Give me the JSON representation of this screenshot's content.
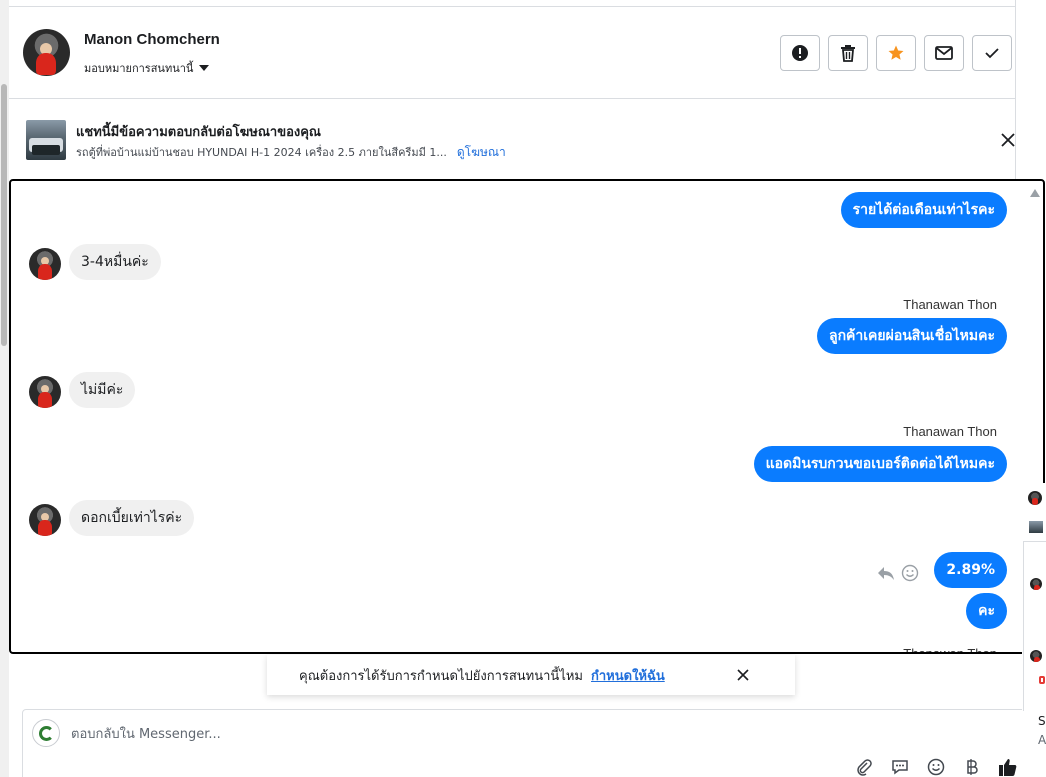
{
  "header": {
    "contact_name": "Manon Chomchern",
    "assign_label": "มอบหมายการสนทนานี้",
    "actions": [
      {
        "name": "report-button",
        "icon": "exclamation-circle-icon"
      },
      {
        "name": "delete-button",
        "icon": "trash-icon"
      },
      {
        "name": "star-button",
        "icon": "star-icon",
        "color": "#f7931e"
      },
      {
        "name": "mark-unread-button",
        "icon": "envelope-icon"
      },
      {
        "name": "mark-done-button",
        "icon": "check-icon"
      }
    ]
  },
  "ad": {
    "title": "แชทนี้มีข้อความตอบกลับต่อโฆษณาของคุณ",
    "description": "รถตู้ที่พ่อบ้านแม่บ้านชอบ HYUNDAI H-1 2024 เครื่อง 2.5 ภายในสีครีมมี 1...",
    "link_label": "ดูโฆษณา"
  },
  "messages": {
    "m1": "รายได้ต่อเดือนเท่าไรคะ",
    "m2": "3-4หมื่นค่ะ",
    "sender1": "Thanawan Thon",
    "m3": "ลูกค้าเคยผ่อนสินเชื่อไหมคะ",
    "m4": "ไม่มีค่ะ",
    "sender2": "Thanawan Thon",
    "m5": "แอดมินรบกวนขอเบอร์ติดต่อได้ไหมคะ",
    "m6": "ดอกเบี้ยเท่าไรค่ะ",
    "m7": "2.89%",
    "m8": "คะ",
    "sender3": "Thanawan Thon"
  },
  "toast": {
    "text": "คุณต้องการได้รับการกำหนดไปยังการสนทนานี้ไหม",
    "link": "กำหนดให้ฉัน"
  },
  "composer": {
    "placeholder": "ตอบกลับใน Messenger..."
  },
  "right_panel": {
    "letter_1": "S",
    "letter_2": "A"
  },
  "colors": {
    "outgoing_bubble": "#0a7cff",
    "incoming_bubble": "#f0f0f0",
    "link": "#216fdb",
    "star": "#f7931e"
  }
}
